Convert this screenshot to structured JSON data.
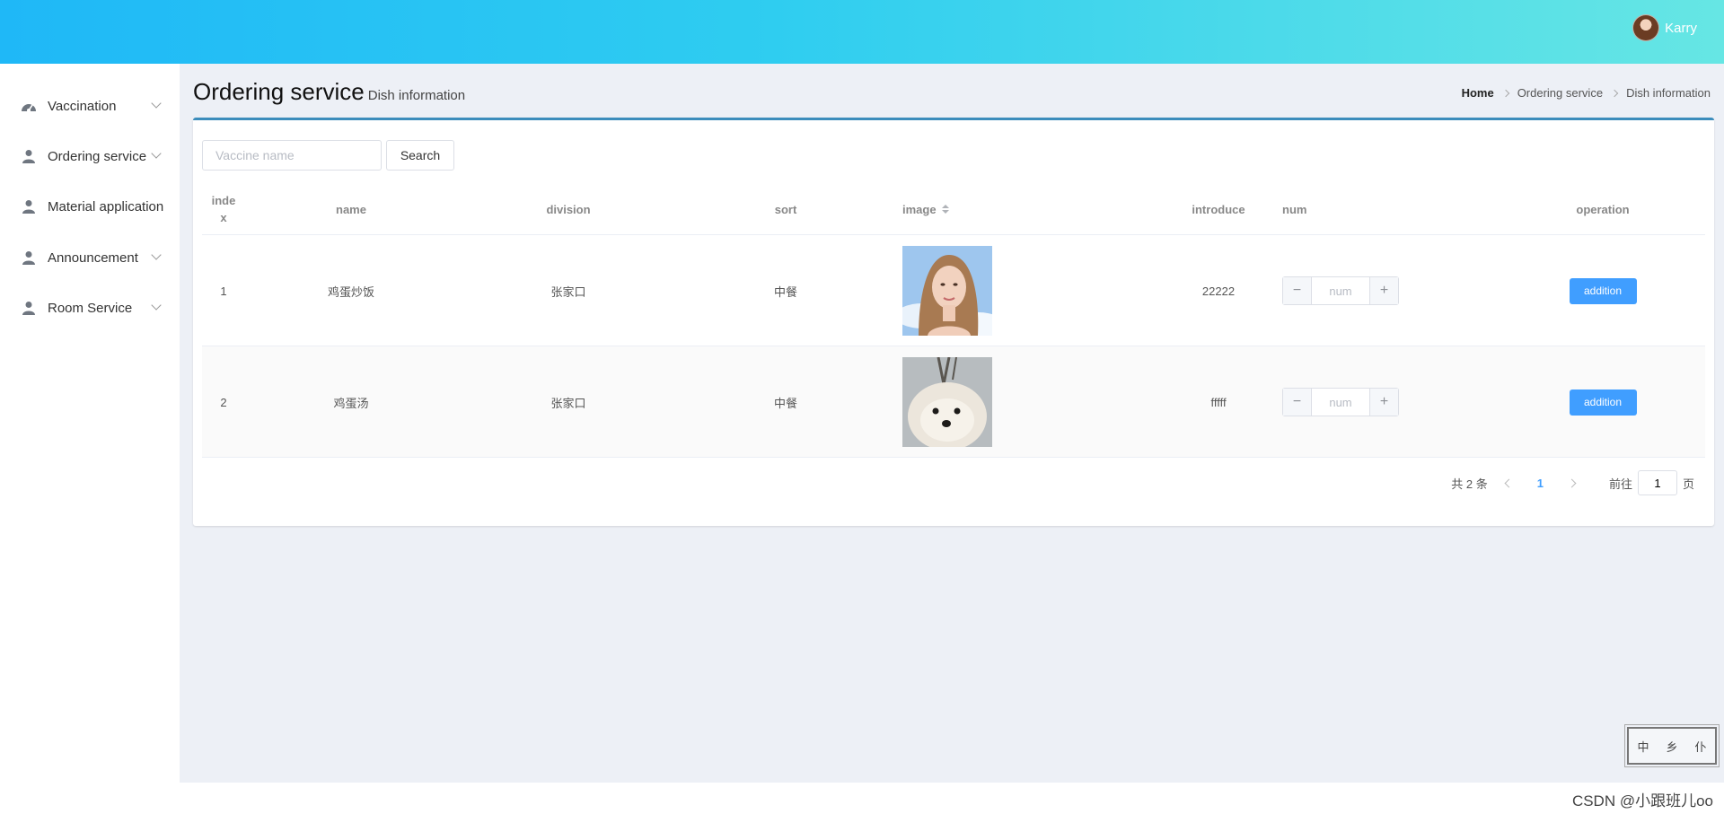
{
  "header": {
    "user_name": "Karry"
  },
  "sidebar": {
    "items": [
      {
        "label": "Vaccination",
        "icon": "dashboard-icon",
        "has_submenu": true
      },
      {
        "label": "Ordering service",
        "icon": "user-icon",
        "has_submenu": true
      },
      {
        "label": "Material application",
        "icon": "user-icon",
        "has_submenu": false
      },
      {
        "label": "Announcement",
        "icon": "user-icon",
        "has_submenu": true
      },
      {
        "label": "Room Service",
        "icon": "user-icon",
        "has_submenu": true
      }
    ]
  },
  "page": {
    "title": "Ordering service",
    "subtitle": "Dish information"
  },
  "breadcrumb": [
    "Home",
    "Ordering service",
    "Dish information"
  ],
  "search": {
    "placeholder": "Vaccine name",
    "button_label": "Search"
  },
  "table": {
    "columns": [
      "index",
      "name",
      "division",
      "sort",
      "image",
      "introduce",
      "num",
      "operation"
    ],
    "rows": [
      {
        "index": "1",
        "name": "鸡蛋炒饭",
        "division": "张家口",
        "sort": "中餐",
        "image": "woman-portrait-photo",
        "introduce": "22222",
        "num_placeholder": "num",
        "action": "addition"
      },
      {
        "index": "2",
        "name": "鸡蛋汤",
        "division": "张家口",
        "sort": "中餐",
        "image": "white-dog-photo",
        "introduce": "fffff",
        "num_placeholder": "num",
        "action": "addition"
      }
    ]
  },
  "pagination": {
    "total_text": "共 2 条",
    "current_page": "1",
    "goto_label": "前往",
    "goto_value": "1",
    "page_suffix": "页"
  },
  "stamp": {
    "chars": [
      "中",
      "乡",
      "仆"
    ]
  },
  "watermark": "CSDN @小跟班儿oo",
  "colors": {
    "header_gradient_start": "#1fb8f7",
    "header_gradient_end": "#66e6e4",
    "panel_border": "#3c8dbc",
    "primary_button": "#409eff",
    "main_background": "#edf0f6"
  }
}
